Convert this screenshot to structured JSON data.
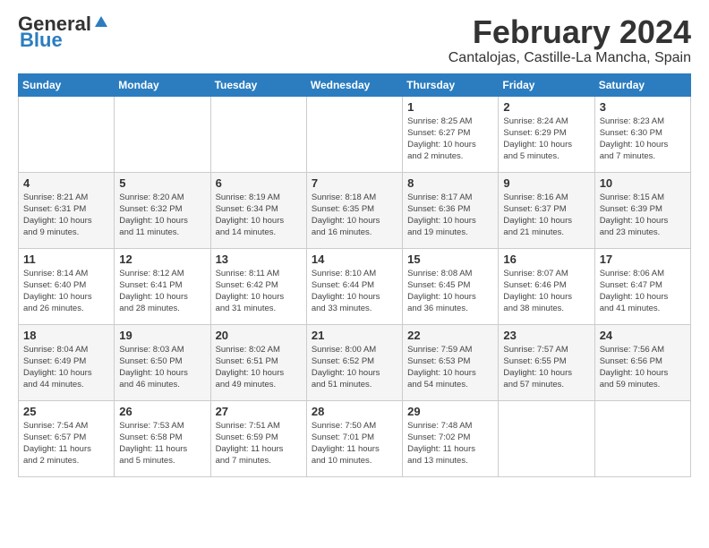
{
  "logo": {
    "general": "General",
    "blue": "Blue"
  },
  "title": "February 2024",
  "subtitle": "Cantalojas, Castille-La Mancha, Spain",
  "days_of_week": [
    "Sunday",
    "Monday",
    "Tuesday",
    "Wednesday",
    "Thursday",
    "Friday",
    "Saturday"
  ],
  "weeks": [
    [
      {
        "day": "",
        "info": ""
      },
      {
        "day": "",
        "info": ""
      },
      {
        "day": "",
        "info": ""
      },
      {
        "day": "",
        "info": ""
      },
      {
        "day": "1",
        "info": "Sunrise: 8:25 AM\nSunset: 6:27 PM\nDaylight: 10 hours\nand 2 minutes."
      },
      {
        "day": "2",
        "info": "Sunrise: 8:24 AM\nSunset: 6:29 PM\nDaylight: 10 hours\nand 5 minutes."
      },
      {
        "day": "3",
        "info": "Sunrise: 8:23 AM\nSunset: 6:30 PM\nDaylight: 10 hours\nand 7 minutes."
      }
    ],
    [
      {
        "day": "4",
        "info": "Sunrise: 8:21 AM\nSunset: 6:31 PM\nDaylight: 10 hours\nand 9 minutes."
      },
      {
        "day": "5",
        "info": "Sunrise: 8:20 AM\nSunset: 6:32 PM\nDaylight: 10 hours\nand 11 minutes."
      },
      {
        "day": "6",
        "info": "Sunrise: 8:19 AM\nSunset: 6:34 PM\nDaylight: 10 hours\nand 14 minutes."
      },
      {
        "day": "7",
        "info": "Sunrise: 8:18 AM\nSunset: 6:35 PM\nDaylight: 10 hours\nand 16 minutes."
      },
      {
        "day": "8",
        "info": "Sunrise: 8:17 AM\nSunset: 6:36 PM\nDaylight: 10 hours\nand 19 minutes."
      },
      {
        "day": "9",
        "info": "Sunrise: 8:16 AM\nSunset: 6:37 PM\nDaylight: 10 hours\nand 21 minutes."
      },
      {
        "day": "10",
        "info": "Sunrise: 8:15 AM\nSunset: 6:39 PM\nDaylight: 10 hours\nand 23 minutes."
      }
    ],
    [
      {
        "day": "11",
        "info": "Sunrise: 8:14 AM\nSunset: 6:40 PM\nDaylight: 10 hours\nand 26 minutes."
      },
      {
        "day": "12",
        "info": "Sunrise: 8:12 AM\nSunset: 6:41 PM\nDaylight: 10 hours\nand 28 minutes."
      },
      {
        "day": "13",
        "info": "Sunrise: 8:11 AM\nSunset: 6:42 PM\nDaylight: 10 hours\nand 31 minutes."
      },
      {
        "day": "14",
        "info": "Sunrise: 8:10 AM\nSunset: 6:44 PM\nDaylight: 10 hours\nand 33 minutes."
      },
      {
        "day": "15",
        "info": "Sunrise: 8:08 AM\nSunset: 6:45 PM\nDaylight: 10 hours\nand 36 minutes."
      },
      {
        "day": "16",
        "info": "Sunrise: 8:07 AM\nSunset: 6:46 PM\nDaylight: 10 hours\nand 38 minutes."
      },
      {
        "day": "17",
        "info": "Sunrise: 8:06 AM\nSunset: 6:47 PM\nDaylight: 10 hours\nand 41 minutes."
      }
    ],
    [
      {
        "day": "18",
        "info": "Sunrise: 8:04 AM\nSunset: 6:49 PM\nDaylight: 10 hours\nand 44 minutes."
      },
      {
        "day": "19",
        "info": "Sunrise: 8:03 AM\nSunset: 6:50 PM\nDaylight: 10 hours\nand 46 minutes."
      },
      {
        "day": "20",
        "info": "Sunrise: 8:02 AM\nSunset: 6:51 PM\nDaylight: 10 hours\nand 49 minutes."
      },
      {
        "day": "21",
        "info": "Sunrise: 8:00 AM\nSunset: 6:52 PM\nDaylight: 10 hours\nand 51 minutes."
      },
      {
        "day": "22",
        "info": "Sunrise: 7:59 AM\nSunset: 6:53 PM\nDaylight: 10 hours\nand 54 minutes."
      },
      {
        "day": "23",
        "info": "Sunrise: 7:57 AM\nSunset: 6:55 PM\nDaylight: 10 hours\nand 57 minutes."
      },
      {
        "day": "24",
        "info": "Sunrise: 7:56 AM\nSunset: 6:56 PM\nDaylight: 10 hours\nand 59 minutes."
      }
    ],
    [
      {
        "day": "25",
        "info": "Sunrise: 7:54 AM\nSunset: 6:57 PM\nDaylight: 11 hours\nand 2 minutes."
      },
      {
        "day": "26",
        "info": "Sunrise: 7:53 AM\nSunset: 6:58 PM\nDaylight: 11 hours\nand 5 minutes."
      },
      {
        "day": "27",
        "info": "Sunrise: 7:51 AM\nSunset: 6:59 PM\nDaylight: 11 hours\nand 7 minutes."
      },
      {
        "day": "28",
        "info": "Sunrise: 7:50 AM\nSunset: 7:01 PM\nDaylight: 11 hours\nand 10 minutes."
      },
      {
        "day": "29",
        "info": "Sunrise: 7:48 AM\nSunset: 7:02 PM\nDaylight: 11 hours\nand 13 minutes."
      },
      {
        "day": "",
        "info": ""
      },
      {
        "day": "",
        "info": ""
      }
    ]
  ]
}
